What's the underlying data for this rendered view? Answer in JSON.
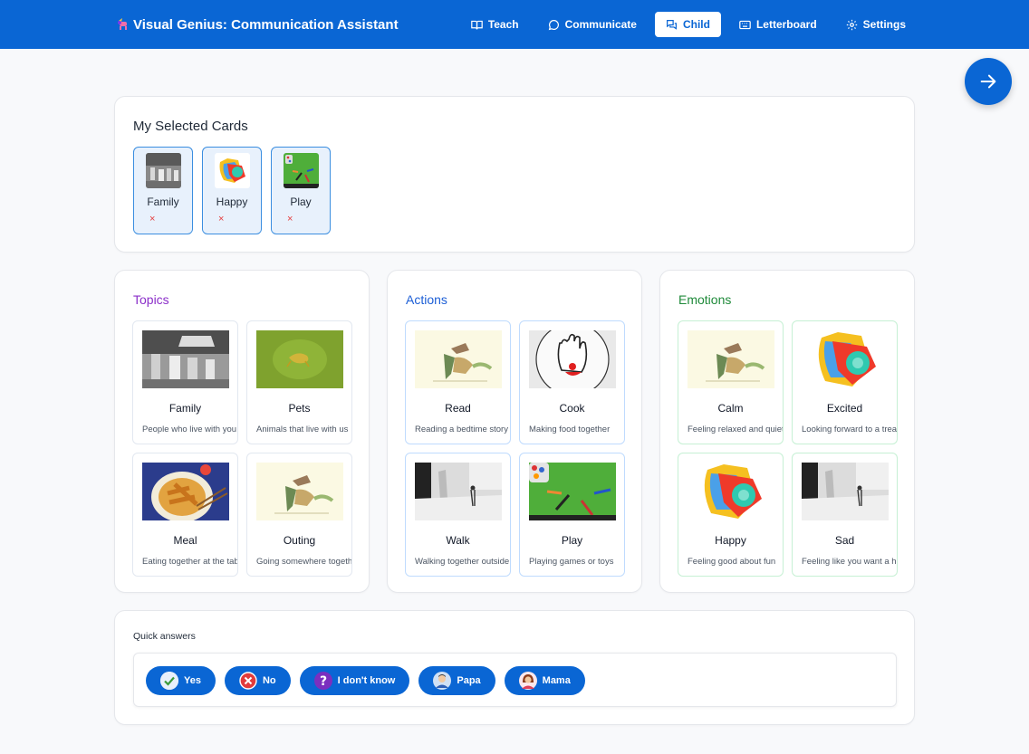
{
  "header": {
    "title": "Visual Genius: Communication Assistant",
    "nav": [
      {
        "label": "Teach",
        "icon": "book-icon"
      },
      {
        "label": "Communicate",
        "icon": "chat-bubble-icon"
      },
      {
        "label": "Child",
        "icon": "chat-bubbles-icon",
        "active": true
      },
      {
        "label": "Letterboard",
        "icon": "keyboard-icon"
      },
      {
        "label": "Settings",
        "icon": "gear-icon"
      }
    ]
  },
  "selected": {
    "title": "My Selected Cards",
    "remove_glyph": "×",
    "cards": [
      {
        "label": "Family",
        "image": "family-photo"
      },
      {
        "label": "Happy",
        "image": "happy-painting"
      },
      {
        "label": "Play",
        "image": "play-photo"
      }
    ]
  },
  "categories": [
    {
      "title": "Topics",
      "color": "#8b2fc9",
      "border": "#e2e8f0",
      "tiles": [
        {
          "title": "Family",
          "desc": "People who live with you",
          "image": "family-photo"
        },
        {
          "title": "Pets",
          "desc": "Animals that live with us",
          "image": "pets-photo"
        },
        {
          "title": "Meal",
          "desc": "Eating together at the table",
          "image": "meal-photo"
        },
        {
          "title": "Outing",
          "desc": "Going somewhere together",
          "image": "sketch-illustration"
        }
      ]
    },
    {
      "title": "Actions",
      "color": "#1d5fd6",
      "border": "#bfdbfe",
      "tiles": [
        {
          "title": "Read",
          "desc": "Reading a bedtime story",
          "image": "sketch-illustration"
        },
        {
          "title": "Cook",
          "desc": "Making food together",
          "image": "glove-illustration"
        },
        {
          "title": "Walk",
          "desc": "Walking together outside",
          "image": "walk-photo"
        },
        {
          "title": "Play",
          "desc": "Playing games or toys",
          "image": "play-photo"
        }
      ]
    },
    {
      "title": "Emotions",
      "color": "#1f8a3a",
      "border": "#c6f0d4",
      "tiles": [
        {
          "title": "Calm",
          "desc": "Feeling relaxed and quiet",
          "image": "sketch-illustration"
        },
        {
          "title": "Excited",
          "desc": "Looking forward to a treat",
          "image": "happy-painting"
        },
        {
          "title": "Happy",
          "desc": "Feeling good about fun",
          "image": "happy-painting"
        },
        {
          "title": "Sad",
          "desc": "Feeling like you want a hug",
          "image": "walk-photo"
        }
      ]
    }
  ],
  "quick": {
    "title": "Quick answers",
    "answers": [
      {
        "label": "Yes",
        "icon": "check-icon"
      },
      {
        "label": "No",
        "icon": "x-circle-icon"
      },
      {
        "label": "I don't know",
        "icon": "question-icon"
      },
      {
        "label": "Papa",
        "icon": "papa-avatar-icon"
      },
      {
        "label": "Mama",
        "icon": "mama-avatar-icon"
      }
    ]
  },
  "colors": {
    "primary": "#0a66d4"
  }
}
